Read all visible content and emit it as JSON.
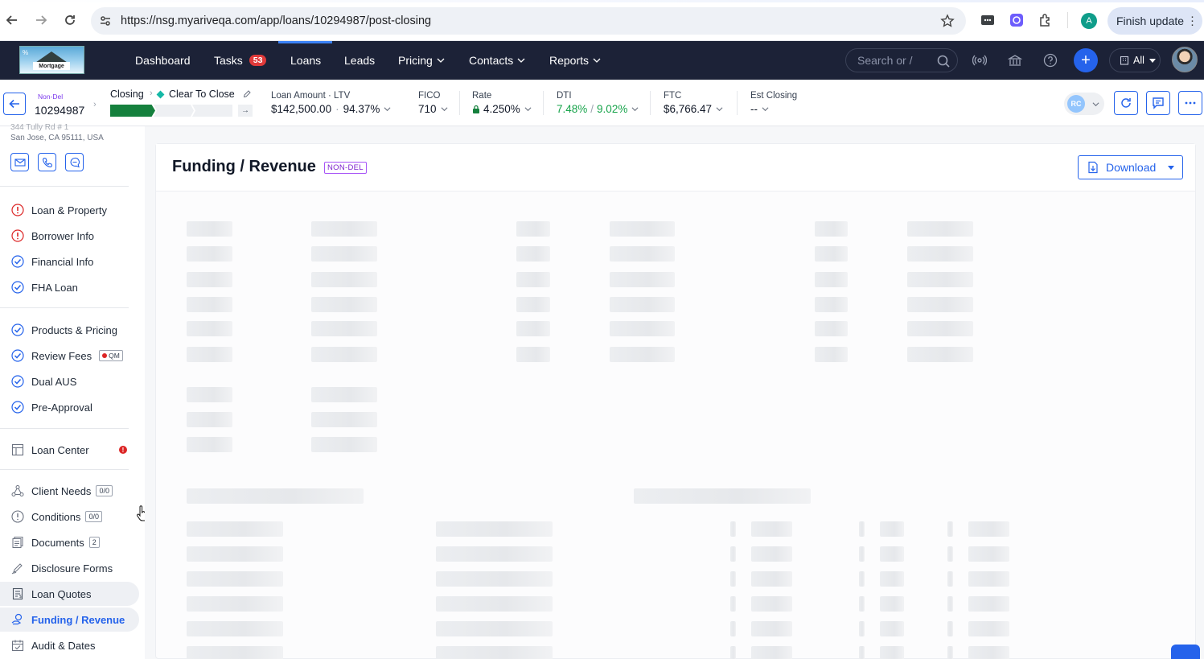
{
  "browser": {
    "url": "https://nsg.myariveqa.com/app/loans/10294987/post-closing",
    "profile_initial": "A",
    "finish_update_label": "Finish update"
  },
  "header": {
    "logo_text": "Mortgage",
    "nav": [
      {
        "label": "Dashboard"
      },
      {
        "label": "Tasks",
        "badge": "53"
      },
      {
        "label": "Loans"
      },
      {
        "label": "Leads"
      },
      {
        "label": "Pricing"
      },
      {
        "label": "Contacts"
      },
      {
        "label": "Reports"
      }
    ],
    "search_placeholder": "Search or /",
    "scope_label": "All"
  },
  "loan_bar": {
    "tag": "Non-Del",
    "loan_number": "10294987",
    "stage": "Closing",
    "sub_stage": "Clear To Close",
    "progress_fraction": 0.33,
    "metrics": {
      "loan_amount_label": "Loan Amount",
      "ltv_label": "LTV",
      "loan_amount": "$142,500.00",
      "ltv": "94.37%",
      "fico_label": "FICO",
      "fico": "710",
      "rate_label": "Rate",
      "rate": "4.250%",
      "dti_label": "DTI",
      "dti_front": "7.48%",
      "dti_sep": "/",
      "dti_back": "9.02%",
      "ftc_label": "FTC",
      "ftc": "$6,766.47",
      "est_closing_label": "Est Closing",
      "est_closing": "--"
    },
    "assignee_initials": "RC"
  },
  "sidebar": {
    "address_line1": "344 Tully Rd # 1",
    "address_line2": "San Jose, CA 95111, USA",
    "groups": [
      [
        {
          "label": "Loan & Property",
          "status": "error"
        },
        {
          "label": "Borrower Info",
          "status": "error"
        },
        {
          "label": "Financial Info",
          "status": "done"
        },
        {
          "label": "FHA Loan",
          "status": "done"
        }
      ],
      [
        {
          "label": "Products & Pricing",
          "status": "done"
        },
        {
          "label": "Review Fees",
          "status": "done",
          "chip": "QM"
        },
        {
          "label": "Dual AUS",
          "status": "done"
        },
        {
          "label": "Pre-Approval",
          "status": "done"
        }
      ],
      [
        {
          "label": "Loan Center"
        }
      ],
      [
        {
          "label": "Client Needs",
          "chip": "0/0"
        },
        {
          "label": "Conditions",
          "chip": "0/0"
        },
        {
          "label": "Documents",
          "chip": "2"
        },
        {
          "label": "Disclosure Forms"
        },
        {
          "label": "Loan Quotes"
        },
        {
          "label": "Funding / Revenue",
          "selected": true
        },
        {
          "label": "Audit & Dates"
        }
      ]
    ]
  },
  "main": {
    "title": "Funding / Revenue",
    "badge": "NON-DEL",
    "download_label": "Download",
    "loading": true
  },
  "colors": {
    "header_bg": "#1c2237",
    "accent": "#2563eb",
    "progress_done": "#15803d",
    "dti_color": "#16a34a",
    "error": "#dc2626"
  }
}
